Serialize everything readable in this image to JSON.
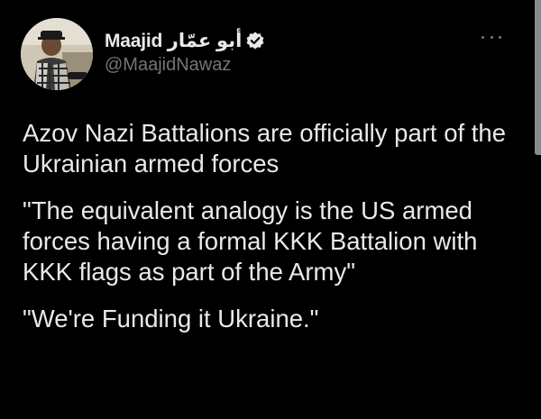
{
  "tweet": {
    "display_name": "Maajid أبو عمّار",
    "handle": "@MaajidNawaz",
    "verified": true,
    "avatar_icon": "profile-photo",
    "more_icon": "ellipsis-icon",
    "paragraphs": [
      "Azov Nazi Battalions are officially part of the Ukrainian armed forces",
      "\"The equivalent analogy is the US armed forces having a formal KKK Battalion with KKK flags as part of the Army\"",
      "\"We're Funding it Ukraine.\""
    ]
  },
  "colors": {
    "background": "#000000",
    "text_primary": "#e7e9ea",
    "text_secondary": "#71767b"
  }
}
